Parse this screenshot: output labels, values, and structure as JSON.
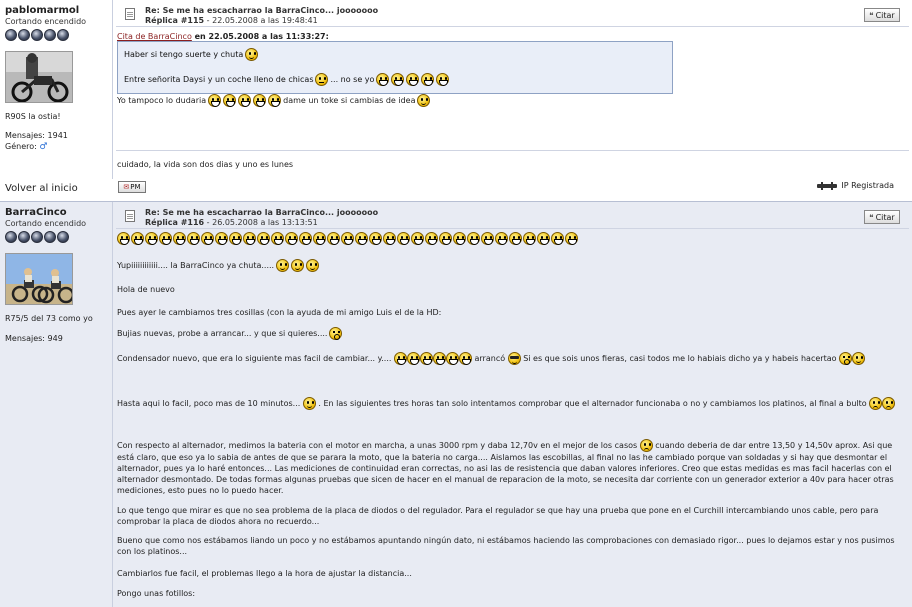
{
  "post1": {
    "user": {
      "name": "pablomarmol",
      "title": "Cortando encendido",
      "caption": "R90S la ostia!",
      "messages": "Mensajes: 1941",
      "gender": "Género:"
    },
    "header": {
      "title": "Re: Se me ha escacharrao la BarraCinco... jooooooo",
      "reply_label": "Réplica #115",
      "reply_date": " - 22.05.2008 a las 19:48:41",
      "cite_label": "Citar"
    },
    "quote": {
      "link": "Cita de BarraCinco",
      "rest": " en 22.05.2008 a las 11:33:27:",
      "line1": "Haber si tengo suerte y chuta",
      "line2": "Entre señorita Daysi y un coche lleno de chicas",
      "line2b": "... no se yo"
    },
    "body": {
      "line_a": "Yo tampoco lo dudaria",
      "line_b": "dame un toke si cambias de idea"
    },
    "signature": "cuidado, la vida son dos dias y uno es lunes"
  },
  "footer": {
    "back": "Volver al inicio",
    "pm": "PM",
    "ip": "IP Registrada"
  },
  "post2": {
    "user": {
      "name": "BarraCinco",
      "title": "Cortando encendido",
      "caption": "R75/5 del 73 como yo",
      "messages": "Mensajes: 949"
    },
    "header": {
      "title": "Re: Se me ha escacharrao la BarraCinco... jooooooo",
      "reply_label": "Réplica #116",
      "reply_date": " - 26.05.2008 a las 13:13:51",
      "cite_label": "Citar"
    },
    "body": {
      "p1": "Yupiiiiiiiiiiii.... la BarraCinco ya chuta.....",
      "p2": "Hola de nuevo",
      "p3": "Pues ayer le cambiamos tres cosillas (con la ayuda de mi amigo Luis el de la HD:",
      "p4": "Bujias nuevas, probe a arrancar... y que si quieres....",
      "p5a": "Condensador nuevo, que era lo siguiente mas facil de cambiar... y....",
      "p5b": "arrancó",
      "p5c": "Si es que sois unos fieras, casi todos me lo habiais dicho ya y habeis hacertao",
      "p6a": "Hasta aqui lo facil, poco mas de 10 minutos...",
      "p6b": ". En las siguientes tres horas tan solo intentamos comprobar que el alternador funcionaba o no y cambiamos los platinos, al final a bulto",
      "p7a": "Con respecto al alternador, medimos la bateria con el motor en marcha, a unas 3000 rpm y daba 12,70v en el mejor de los casos",
      "p7b": "cuando deberia de dar entre 13,50 y 14,50v aprox. Asi que está claro, que eso ya lo sabia de antes de que se parara la moto, que la bateria no carga.... Aislamos las escobillas, al final no las he cambiado porque van soldadas y si hay que desmontar el alternador, pues ya lo haré entonces... Las mediciones de continuidad eran correctas, no asi las de resistencia que daban valores inferiores. Creo que estas medidas es mas facil hacerlas con el alternador desmontado. De todas formas algunas pruebas que sicen de hacer en el manual de reparacion de la moto, se necesita dar corriente con un generador exterior a 40v para hacer otras mediciones, esto pues no lo puedo hacer.",
      "p8": "Lo que tengo que mirar es que no sea problema de la placa de diodos o del regulador. Para el regulador se que hay una prueba que pone en el Curchill intercambiando unos cable, pero para comprobar la placa de diodos ahora no recuerdo...",
      "p9": "Bueno que como nos estábamos liando un poco y no estábamos apuntando ningún dato, ni estábamos haciendo las comprobaciones con demasiado rigor... pues lo dejamos estar y nos pusimos con los platinos...",
      "p10": "Cambiarlos fue facil, el problemas llego a la hora de ajustar la distancia...",
      "p11": "Pongo unas fotillos:"
    }
  },
  "icons": {
    "rank_star": "rank-star-icon",
    "document": "document-icon",
    "smiley": "smiley-icon",
    "ip": "ip-icon",
    "pm": "pm-icon"
  }
}
